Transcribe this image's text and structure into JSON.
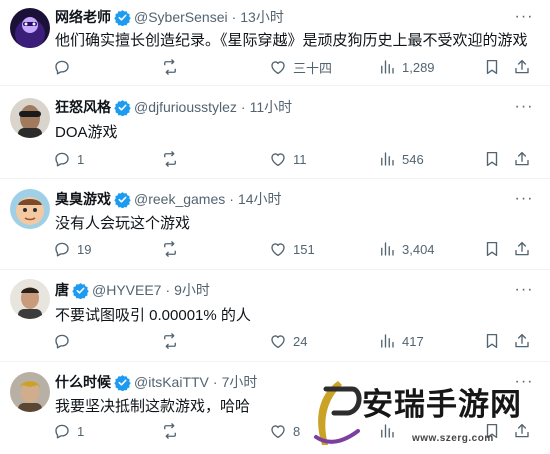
{
  "tweets": [
    {
      "name": "网络老师",
      "verified": true,
      "handle": "@SyberSensei",
      "dot": "·",
      "time": "13小时",
      "text": "他们确实擅长创造纪录。《星际穿越》是顽皮狗历史上最不受欢迎的游戏",
      "replies": "",
      "reposts": "",
      "likes": "三十四",
      "views": "1,289"
    },
    {
      "name": "狂怒风格",
      "verified": true,
      "handle": "@djfuriousstylez",
      "dot": "·",
      "time": "11小时",
      "text": "DOA游戏",
      "replies": "1",
      "reposts": "",
      "likes": "11",
      "views": "546"
    },
    {
      "name": "臭臭游戏",
      "verified": true,
      "handle": "@reek_games",
      "dot": "·",
      "time": "14小时",
      "text": "没有人会玩这个游戏",
      "replies": "19",
      "reposts": "",
      "likes": "151",
      "views": "3,404"
    },
    {
      "name": "唐",
      "verified": true,
      "handle": "@HYVEE7",
      "dot": "·",
      "time": "9小时",
      "text": "不要试图吸引 0.00001% 的人",
      "replies": "",
      "reposts": "",
      "likes": "24",
      "views": "417"
    },
    {
      "name": "什么时候",
      "verified": true,
      "handle": "@itsKaiTTV",
      "dot": "·",
      "time": "7小时",
      "text": "我要坚决抵制这款游戏，哈哈",
      "replies": "1",
      "reposts": "",
      "likes": "8",
      "views": ""
    }
  ],
  "more_glyph": "···",
  "watermark": {
    "text": "安瑞手游网",
    "url": "www.szerg.com"
  },
  "colors": {
    "text": "#0f1419",
    "secondary": "#536471",
    "verified": "#1d9bf0",
    "divider": "#eff3f4",
    "watermark_accent": "#c9a227"
  },
  "icons": [
    "verified-badge-icon",
    "more-icon",
    "reply-icon",
    "repost-icon",
    "like-icon",
    "views-icon",
    "bookmark-icon",
    "share-icon"
  ]
}
